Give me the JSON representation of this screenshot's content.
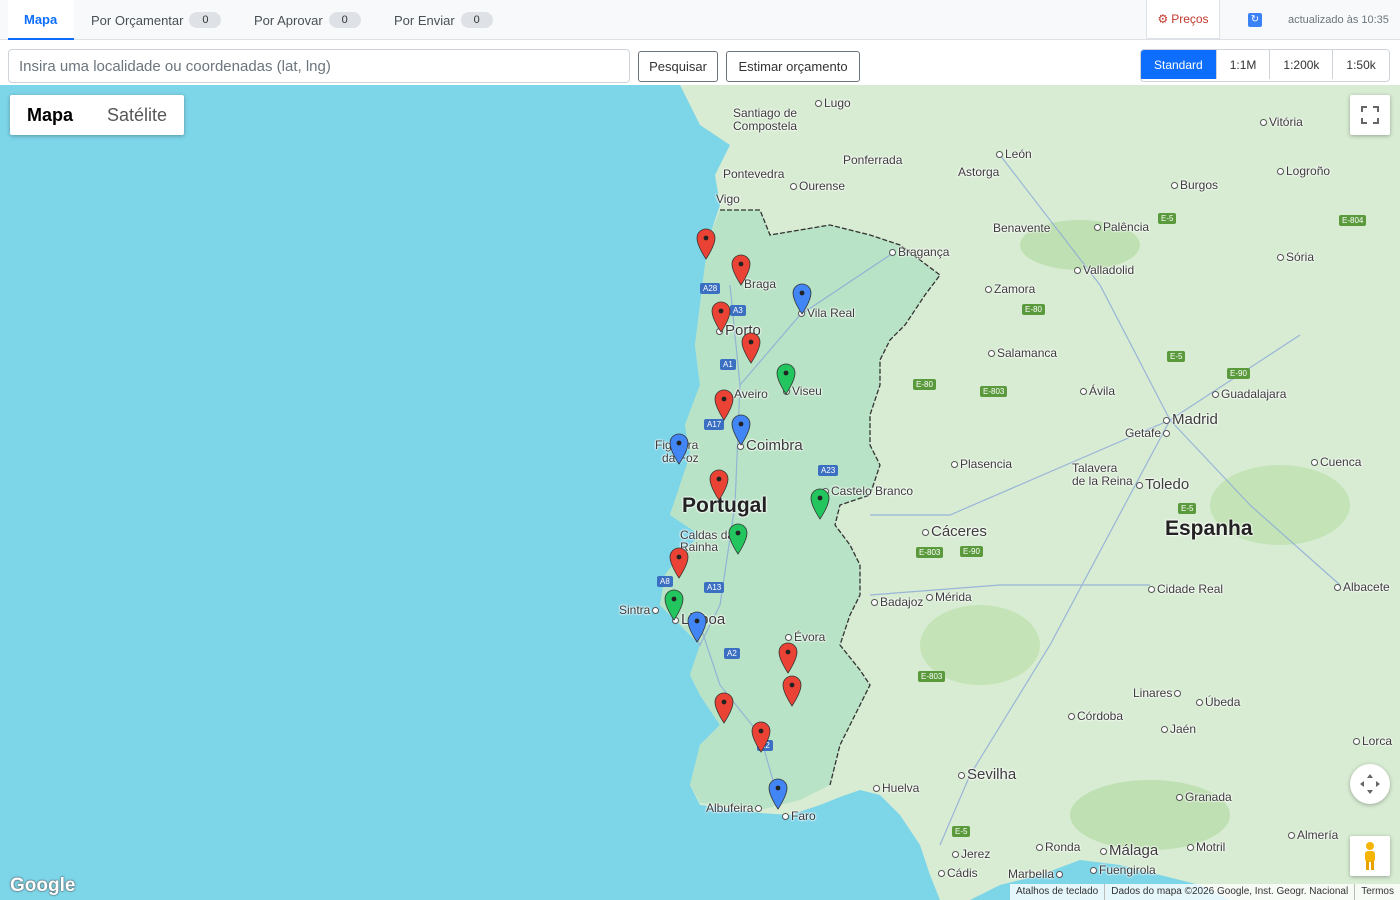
{
  "tabs": [
    {
      "label": "Mapa",
      "count": null
    },
    {
      "label": "Por Orçamentar",
      "count": "0"
    },
    {
      "label": "Por Aprovar",
      "count": "0"
    },
    {
      "label": "Por Enviar",
      "count": "0"
    }
  ],
  "header": {
    "prices_label": "Preços",
    "updated_text": "actualizado às 10:35"
  },
  "toolbar": {
    "search_placeholder": "Insira uma localidade ou coordenadas (lat, lng)",
    "search_value": "",
    "search_button": "Pesquisar",
    "estimate_button": "Estimar orçamento",
    "scales": [
      "Standard",
      "1:1M",
      "1:200k",
      "1:50k"
    ],
    "active_scale": "Standard"
  },
  "map": {
    "type_controls": [
      "Mapa",
      "Satélite"
    ],
    "active_type": "Mapa",
    "attribution": [
      "Atalhos de teclado",
      "Dados do mapa ©2026 Google, Inst. Geogr. Nacional",
      "Termos"
    ],
    "logo": "Google",
    "countries": [
      "Portugal",
      "Espanha"
    ],
    "cities": [
      "Lugo",
      "Santiago de",
      "Compostela",
      "Vitória",
      "Ponferrada",
      "León",
      "Pontevedra",
      "Ourense",
      "Astorga",
      "Burgos",
      "Logroño",
      "Vigo",
      "Benavente",
      "Palência",
      "Bragança",
      "Sória",
      "Braga",
      "Valladolid",
      "Zamora",
      "Vila Real",
      "Porto",
      "Salamanca",
      "Aveiro",
      "Viseu",
      "Ávila",
      "Guadalajara",
      "Madrid",
      "Coimbra",
      "Figueira",
      "da Foz",
      "Getafe",
      "Plasencia",
      "Cuenca",
      "Talavera",
      "de la Reina",
      "Toledo",
      "Castelo Branco",
      "Caldas da",
      "Rainha",
      "Cáceres",
      "Cidade Real",
      "Albacete",
      "Sintra",
      "Lisboa",
      "Badajoz",
      "Mérida",
      "Évora",
      "Linares",
      "Úbeda",
      "Córdoba",
      "Jaén",
      "Lorca",
      "Sevilha",
      "Huelva",
      "Granada",
      "Albufeira",
      "Faro",
      "Almería",
      "Ronda",
      "Málaga",
      "Motril",
      "Jerez",
      "Marbella",
      "Fuengirola",
      "Cádis"
    ],
    "marker_colors": {
      "red": "#ea4335",
      "blue": "#4285f4",
      "green": "#22c55e"
    },
    "markers": [
      {
        "color": "red"
      },
      {
        "color": "red"
      },
      {
        "color": "blue"
      },
      {
        "color": "red"
      },
      {
        "color": "red"
      },
      {
        "color": "green"
      },
      {
        "color": "red"
      },
      {
        "color": "blue"
      },
      {
        "color": "blue"
      },
      {
        "color": "red"
      },
      {
        "color": "green"
      },
      {
        "color": "green"
      },
      {
        "color": "red"
      },
      {
        "color": "green"
      },
      {
        "color": "blue"
      },
      {
        "color": "red"
      },
      {
        "color": "red"
      },
      {
        "color": "red"
      },
      {
        "color": "red"
      },
      {
        "color": "blue"
      }
    ],
    "road_labels": [
      "A28",
      "A3",
      "A1",
      "A17",
      "A23",
      "A8",
      "A13",
      "A2",
      "A2",
      "E-5",
      "E-804",
      "E-80",
      "E-5",
      "E-90",
      "E-80",
      "E-803",
      "E-5",
      "E-803",
      "E-90",
      "E-803",
      "E-5"
    ]
  }
}
